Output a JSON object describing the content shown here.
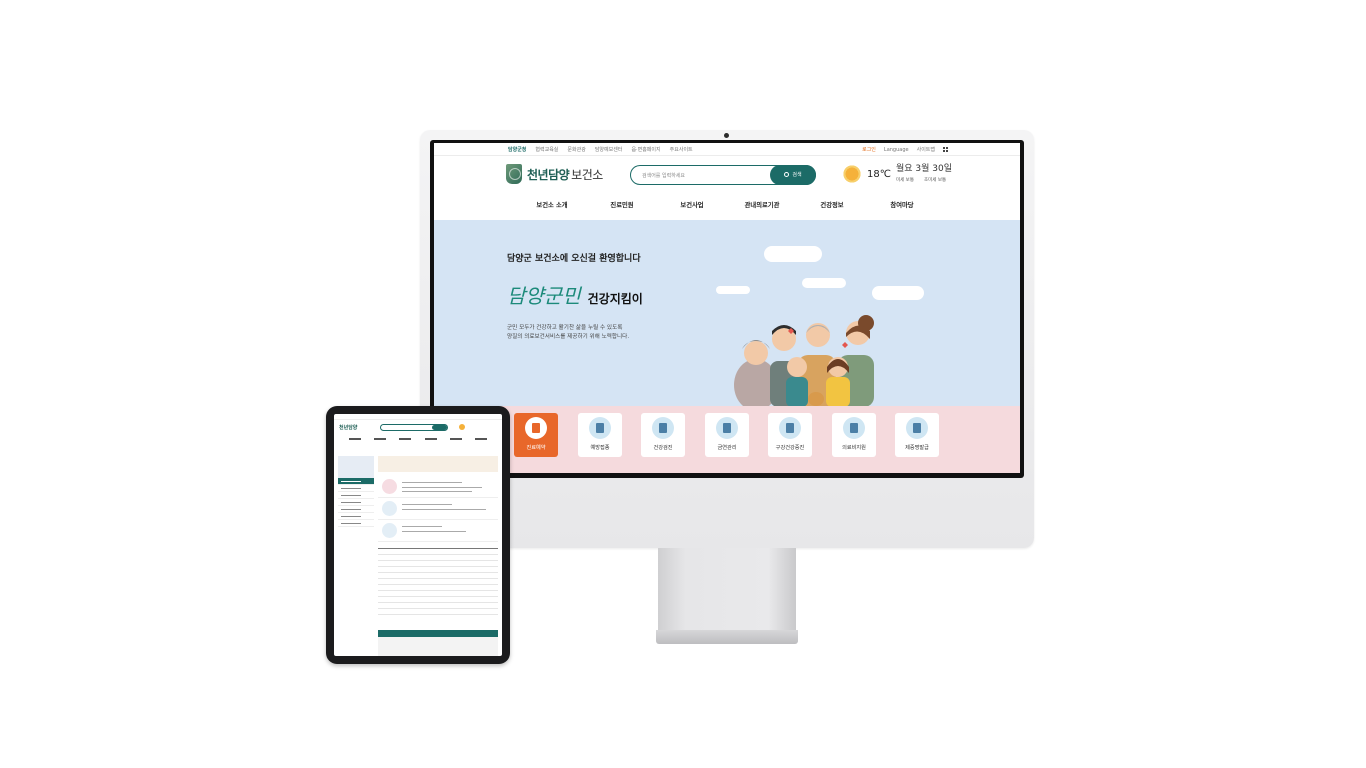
{
  "site": {
    "util_links": [
      "담양군청",
      "협력교육실",
      "문화관광",
      "담양예보센터",
      "읍·면홈페이지",
      "주요사이트"
    ],
    "login": "로그인",
    "language": "Language",
    "sitemap": "사이트맵",
    "logo_main": "천년담양",
    "logo_sub": "보건소",
    "search_placeholder": "검색어를 입력하세요",
    "search_button": "검색",
    "weather": {
      "temperature": "18℃",
      "date": "3월 30일",
      "day": "월요",
      "dust_label_1": "미세 보통",
      "dust_label_2": "초미세 보통"
    },
    "nav": [
      "보건소 소개",
      "진료민원",
      "보건사업",
      "관내의료기관",
      "건강정보",
      "참여마당"
    ],
    "hero": {
      "welcome": "담양군 보건소에 오신걸 환영합니다",
      "slogan_script": "담양군민",
      "slogan_bold": "건강지킴이",
      "desc_line1": "군민 모두가 건강하고 활기찬 삶을 누릴 수 있도록",
      "desc_line2": "양질의 의료보건서비스를 제공하기 위해 노력합니다."
    },
    "quick_menu": [
      "진료예약",
      "예방접종",
      "건강검진",
      "금연관리",
      "구강건강증진",
      "의료비지원",
      "제증명발급"
    ]
  },
  "colors": {
    "brand": "#1c6b67",
    "accent": "#e8672a",
    "hero_bg": "#d5e4f4",
    "quick_bg": "#f5dadd"
  }
}
